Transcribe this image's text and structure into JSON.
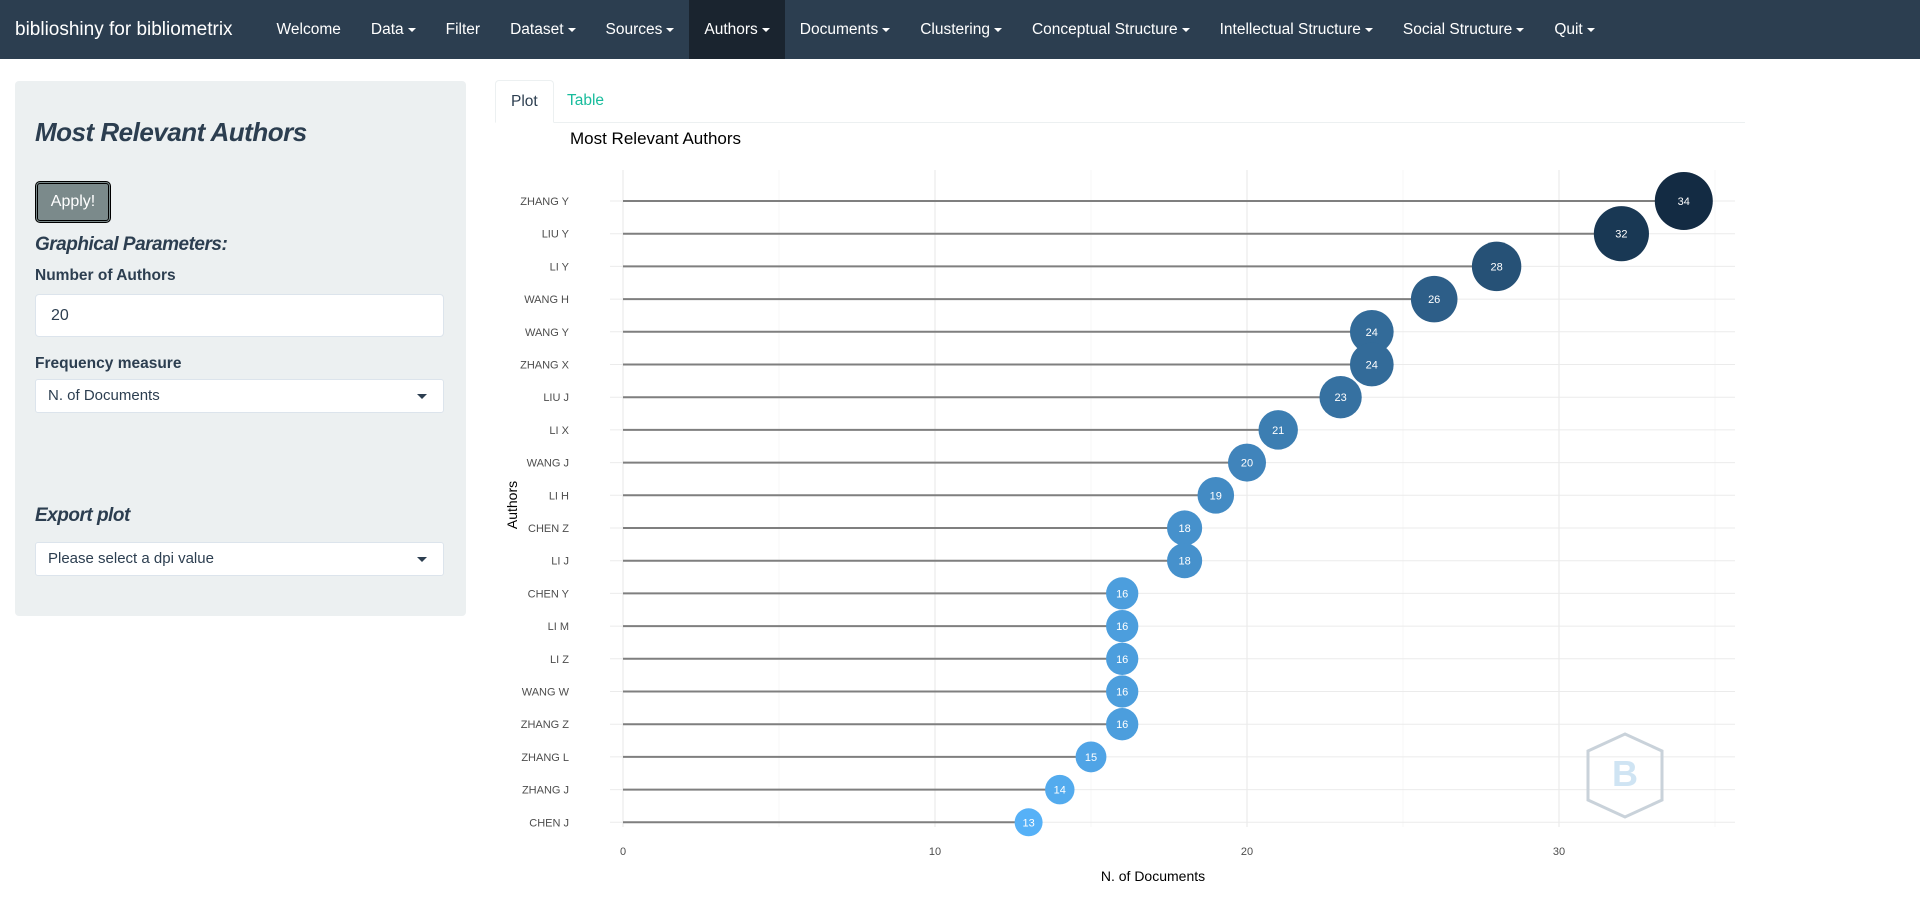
{
  "navbar": {
    "brand": "biblioshiny for bibliometrix",
    "items": [
      {
        "label": "Welcome",
        "dropdown": false,
        "active": false
      },
      {
        "label": "Data",
        "dropdown": true,
        "active": false
      },
      {
        "label": "Filter",
        "dropdown": false,
        "active": false
      },
      {
        "label": "Dataset",
        "dropdown": true,
        "active": false
      },
      {
        "label": "Sources",
        "dropdown": true,
        "active": false
      },
      {
        "label": "Authors",
        "dropdown": true,
        "active": true
      },
      {
        "label": "Documents",
        "dropdown": true,
        "active": false
      },
      {
        "label": "Clustering",
        "dropdown": true,
        "active": false
      },
      {
        "label": "Conceptual Structure",
        "dropdown": true,
        "active": false
      },
      {
        "label": "Intellectual Structure",
        "dropdown": true,
        "active": false
      },
      {
        "label": "Social Structure",
        "dropdown": true,
        "active": false
      },
      {
        "label": "Quit",
        "dropdown": true,
        "active": false
      }
    ]
  },
  "sidebar": {
    "title": "Most Relevant Authors",
    "apply_label": "Apply!",
    "graphical_params_title": "Graphical Parameters:",
    "num_authors_label": "Number of Authors",
    "num_authors_value": "20",
    "freq_measure_label": "Frequency measure",
    "freq_measure_value": "N. of Documents",
    "export_title": "Export plot",
    "dpi_placeholder": "Please select a dpi value"
  },
  "tabs": {
    "plot": "Plot",
    "table": "Table"
  },
  "chart_data": {
    "type": "scatter",
    "title": "Most Relevant Authors",
    "xlabel": "N. of Documents",
    "ylabel": "Authors",
    "xlim": [
      0,
      35
    ],
    "xticks": [
      0,
      10,
      20,
      30
    ],
    "grid": true,
    "categories": [
      "ZHANG Y",
      "LIU Y",
      "LI Y",
      "WANG H",
      "WANG Y",
      "ZHANG X",
      "LIU J",
      "LI X",
      "WANG J",
      "LI H",
      "CHEN Z",
      "LI J",
      "CHEN Y",
      "LI M",
      "LI Z",
      "WANG W",
      "ZHANG Z",
      "ZHANG L",
      "ZHANG J",
      "CHEN J"
    ],
    "values": [
      34,
      32,
      28,
      26,
      24,
      24,
      23,
      21,
      20,
      19,
      18,
      18,
      16,
      16,
      16,
      16,
      16,
      15,
      14,
      13
    ],
    "colors": {
      "low": "#56b1f7",
      "high": "#132b43"
    }
  }
}
